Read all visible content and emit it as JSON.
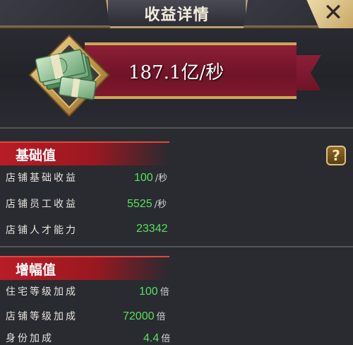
{
  "window": {
    "title": "收益详情",
    "close_glyph": "✕"
  },
  "income": {
    "rate": "187.1亿/秒",
    "icon": "money-stack-emblem"
  },
  "sections": [
    {
      "title": "基础值",
      "rows": [
        {
          "label": "店铺基础收益",
          "value": "100",
          "unit": "/秒"
        },
        {
          "label": "店铺员工收益",
          "value": "5525",
          "unit": "/秒"
        },
        {
          "label": "店铺人才能力",
          "value": "23342",
          "unit": ""
        }
      ]
    },
    {
      "title": "增幅值",
      "rows": [
        {
          "label": "住宅等级加成",
          "value": "100",
          "unit": "倍"
        },
        {
          "label": "店铺等级加成",
          "value": "72000",
          "unit": "倍"
        },
        {
          "label": "身份加成",
          "value": "4.4",
          "unit": "倍"
        }
      ]
    }
  ],
  "help_button": {
    "label": "?"
  },
  "colors": {
    "value_green": "#55e35a",
    "section_red": "#b81c27",
    "banner_crimson": "#7a1730",
    "gold_trim": "#cfa657"
  }
}
